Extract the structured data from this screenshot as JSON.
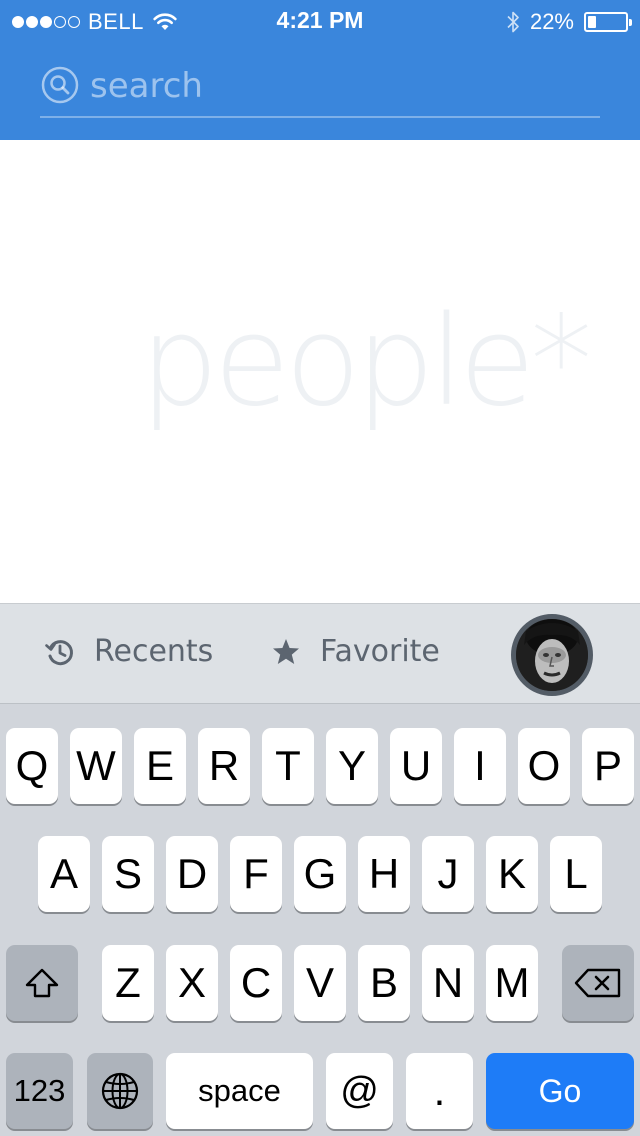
{
  "status_bar": {
    "carrier": "BELL",
    "time": "4:21 PM",
    "battery_percent": "22%",
    "battery_level": 0.22,
    "signal_bars": 3,
    "signal_total": 5,
    "icons": [
      "wifi-icon",
      "bluetooth-icon",
      "battery-icon"
    ]
  },
  "search": {
    "placeholder": "search",
    "value": "",
    "icon": "search-icon"
  },
  "watermark": "people*",
  "suggestion_bar": {
    "recents_label": "Recents",
    "recents_icon": "history-icon",
    "favorite_label": "Favorite",
    "favorite_icon": "star-icon",
    "avatar": "user-avatar"
  },
  "keyboard": {
    "row1": [
      "Q",
      "W",
      "E",
      "R",
      "T",
      "Y",
      "U",
      "I",
      "O",
      "P"
    ],
    "row2": [
      "A",
      "S",
      "D",
      "F",
      "G",
      "H",
      "J",
      "K",
      "L"
    ],
    "row3": [
      "Z",
      "X",
      "C",
      "V",
      "B",
      "N",
      "M"
    ],
    "numbers_label": "123",
    "space_label": "space",
    "at_label": "@",
    "dot_label": ".",
    "go_label": "Go",
    "shift_icon": "shift-icon",
    "globe_icon": "globe-icon",
    "delete_icon": "backspace-icon"
  },
  "colors": {
    "header": "#3a86dc",
    "go_key": "#1e7cf7",
    "keyboard_bg": "#d1d5db",
    "suggest_bg": "#dde1e5"
  }
}
